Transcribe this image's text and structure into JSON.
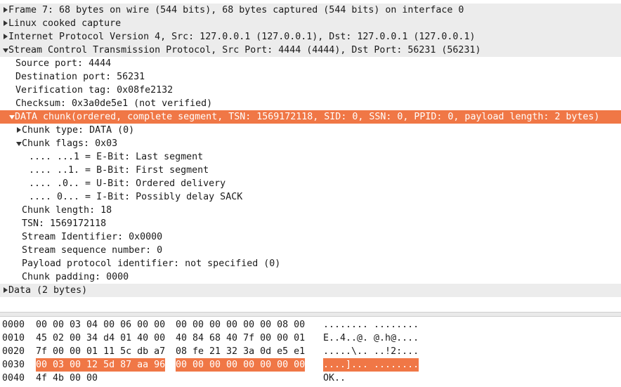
{
  "tree": [
    {
      "text": "Frame 7: 68 bytes on wire (544 bits), 68 bytes captured (544 bits) on interface 0",
      "toggle": "right",
      "indent": 3,
      "style": "gray"
    },
    {
      "text": "Linux cooked capture",
      "toggle": "right",
      "indent": 3,
      "style": "gray"
    },
    {
      "text": "Internet Protocol Version 4, Src: 127.0.0.1 (127.0.0.1), Dst: 127.0.0.1 (127.0.0.1)",
      "toggle": "right",
      "indent": 3,
      "style": "gray"
    },
    {
      "text": "Stream Control Transmission Protocol, Src Port: 4444 (4444), Dst Port: 56231 (56231)",
      "toggle": "down",
      "indent": 3,
      "style": "gray"
    },
    {
      "text": "Source port: 4444",
      "toggle": "none",
      "indent": 22,
      "style": ""
    },
    {
      "text": "Destination port: 56231",
      "toggle": "none",
      "indent": 22,
      "style": ""
    },
    {
      "text": "Verification tag: 0x08fe2132",
      "toggle": "none",
      "indent": 22,
      "style": ""
    },
    {
      "text": "Checksum: 0x3a0de5e1 (not verified)",
      "toggle": "none",
      "indent": 22,
      "style": ""
    },
    {
      "text": "DATA chunk(ordered, complete segment, TSN: 1569172118, SID: 0, SSN: 0, PPID: 0, payload length: 2 bytes)",
      "toggle": "down",
      "indent": 12,
      "style": "sel"
    },
    {
      "text": "Chunk type: DATA (0)",
      "toggle": "right",
      "indent": 22,
      "style": ""
    },
    {
      "text": "Chunk flags: 0x03",
      "toggle": "down",
      "indent": 22,
      "style": ""
    },
    {
      "text": ".... ...1 = E-Bit: Last segment",
      "toggle": "none",
      "indent": 41,
      "style": ""
    },
    {
      "text": ".... ..1. = B-Bit: First segment",
      "toggle": "none",
      "indent": 41,
      "style": ""
    },
    {
      "text": ".... .0.. = U-Bit: Ordered delivery",
      "toggle": "none",
      "indent": 41,
      "style": ""
    },
    {
      "text": ".... 0... = I-Bit: Possibly delay SACK",
      "toggle": "none",
      "indent": 41,
      "style": ""
    },
    {
      "text": "Chunk length: 18",
      "toggle": "none",
      "indent": 31,
      "style": ""
    },
    {
      "text": "TSN: 1569172118",
      "toggle": "none",
      "indent": 31,
      "style": ""
    },
    {
      "text": "Stream Identifier: 0x0000",
      "toggle": "none",
      "indent": 31,
      "style": ""
    },
    {
      "text": "Stream sequence number: 0",
      "toggle": "none",
      "indent": 31,
      "style": ""
    },
    {
      "text": "Payload protocol identifier: not specified (0)",
      "toggle": "none",
      "indent": 31,
      "style": ""
    },
    {
      "text": "Chunk padding: 0000",
      "toggle": "none",
      "indent": 31,
      "style": ""
    },
    {
      "text": "Data (2 bytes)",
      "toggle": "right",
      "indent": 3,
      "style": "gray"
    }
  ],
  "hex": [
    {
      "offset": "0000",
      "b1": "00 00 03 04 00 06 00 00",
      "b2": "00 00 00 00 00 00 08 00",
      "ascii": "........ ........",
      "highlight": false
    },
    {
      "offset": "0010",
      "b1": "45 02 00 34 d4 01 40 00",
      "b2": "40 84 68 40 7f 00 00 01",
      "ascii": "E..4..@. @.h@....",
      "highlight": false
    },
    {
      "offset": "0020",
      "b1": "7f 00 00 01 11 5c db a7",
      "b2": "08 fe 21 32 3a 0d e5 e1",
      "ascii": ".....\\.. ..!2:...",
      "highlight": false
    },
    {
      "offset": "0030",
      "b1": "00 03 00 12 5d 87 aa 96",
      "b2": "00 00 00 00 00 00 00 00",
      "ascii": "....]... ........",
      "highlight": true
    },
    {
      "offset": "0040",
      "b1": "4f 4b 00 00",
      "b2": "",
      "ascii": "OK..",
      "highlight": false
    }
  ],
  "colors": {
    "selection": "#f07746",
    "header_row": "#ececec"
  }
}
